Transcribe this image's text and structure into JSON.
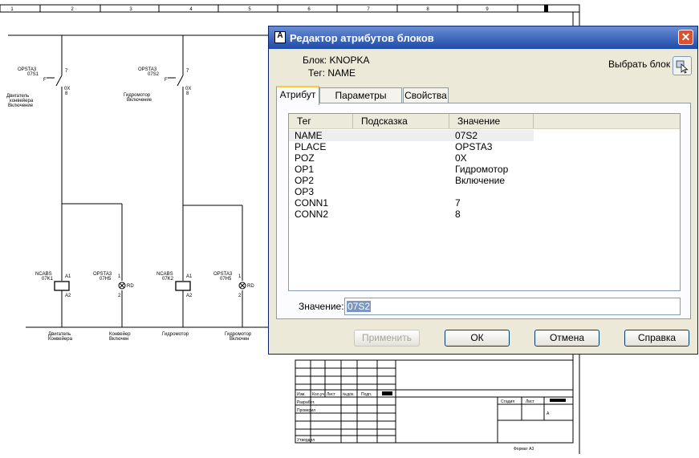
{
  "drawing": {
    "ruler_numbers": [
      "1",
      "2",
      "3",
      "4",
      "5",
      "6",
      "7",
      "8",
      "9"
    ],
    "switch1": {
      "tag": "OPSTA3",
      "id": "07S1",
      "pin_top": "7",
      "pin_bottom": "8",
      "mark": "F",
      "suffix": "0X",
      "desc1": "Двигатель",
      "desc2": "конвейера",
      "desc3": "Включение"
    },
    "switch2": {
      "tag": "OPSTA3",
      "id": "07S2",
      "pin_top": "7",
      "pin_bottom": "8",
      "mark": "F",
      "suffix": "0X",
      "desc1": "Гидромотор",
      "desc2": "Включение"
    },
    "coil1": {
      "tag": "NCABS",
      "id": "07K1",
      "pin_top": "A1",
      "pin_bottom": "A2",
      "label1": "Двигатель",
      "label2": "Конвейера"
    },
    "lamp1": {
      "tag": "OPSTA3",
      "id": "07H5",
      "pin_top": "1",
      "pin_bottom": "2",
      "suffix": "RD",
      "label1": "Конвейер",
      "label2": "Включен"
    },
    "coil2": {
      "tag": "NCABS",
      "id": "07K2",
      "pin_top": "A1",
      "pin_bottom": "A2",
      "label1": "Гидромотор"
    },
    "lamp2": {
      "tag": "OPSTA3",
      "id": "07H5",
      "pin_top": "1",
      "pin_bottom": "2",
      "suffix": "RD",
      "label1": "Гидромотор",
      "label2": "Включен"
    },
    "title_block": {
      "h1": "Изм.",
      "h2": "Кол.уч",
      "h3": "Лист",
      "h4": "№док.",
      "h5": "Подп.",
      "dev": "Разработ.",
      "check": "Проверил",
      "approved": "Утвердил",
      "stage": "Стадия",
      "sheet": "Лист",
      "sheets": "Листов",
      "sheet_num": "А",
      "format": "Формат А3"
    }
  },
  "dialog": {
    "title": "Редактор атрибутов блоков",
    "app_icon": "A",
    "close_icon": "close-icon",
    "block_label": "Блок: KNOPKA",
    "tag_label": "Тег: NAME",
    "select_block": "Выбрать блок",
    "tabs": [
      "Атрибут",
      "Параметры текста",
      "Свойства"
    ],
    "columns": [
      "Тег",
      "Подсказка",
      "Значение"
    ],
    "rows": [
      {
        "tag": "NAME",
        "prompt": "",
        "value": "07S2"
      },
      {
        "tag": "PLACE",
        "prompt": "",
        "value": "OPSTA3"
      },
      {
        "tag": "POZ",
        "prompt": "",
        "value": "0X"
      },
      {
        "tag": "OP1",
        "prompt": "",
        "value": "Гидромотор"
      },
      {
        "tag": "OP2",
        "prompt": "",
        "value": "Включение"
      },
      {
        "tag": "OP3",
        "prompt": "",
        "value": ""
      },
      {
        "tag": "CONN1",
        "prompt": "",
        "value": "7"
      },
      {
        "tag": "CONN2",
        "prompt": "",
        "value": "8"
      }
    ],
    "value_label": "Значение:",
    "value_text": "07S2",
    "buttons": {
      "apply": "Применить",
      "ok": "ОК",
      "cancel": "Отмена",
      "help": "Справка"
    }
  }
}
